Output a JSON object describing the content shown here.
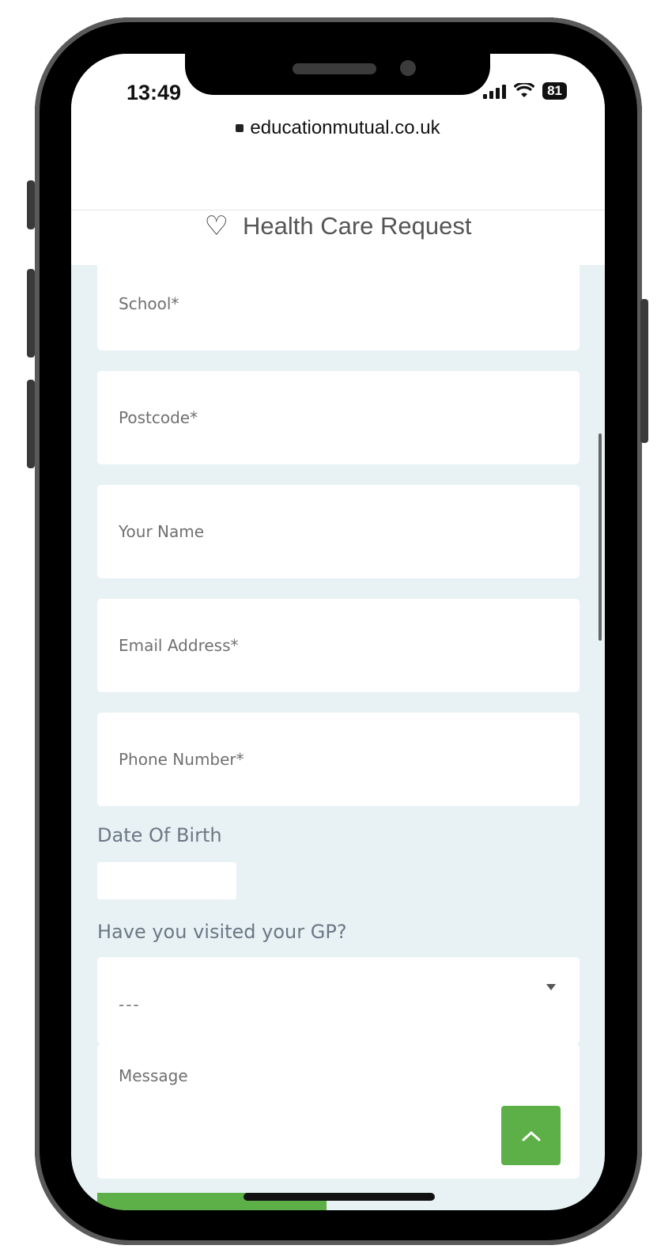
{
  "status": {
    "time": "13:49",
    "battery": "81"
  },
  "browser": {
    "url": "educationmutual.co.uk"
  },
  "page": {
    "title": "Health Care Request"
  },
  "form": {
    "school_placeholder": "School*",
    "postcode_placeholder": "Postcode*",
    "name_placeholder": "Your Name",
    "email_placeholder": "Email Address*",
    "phone_placeholder": "Phone Number*",
    "dob_label": "Date Of Birth",
    "gp_label": "Have you visited your GP?",
    "gp_selected": "---",
    "message_placeholder": "Message"
  },
  "icons": {
    "heart": "heart-icon",
    "to_top": "chevron-up-icon"
  },
  "colors": {
    "accent": "#5daf47",
    "background": "#e8f2f5"
  }
}
